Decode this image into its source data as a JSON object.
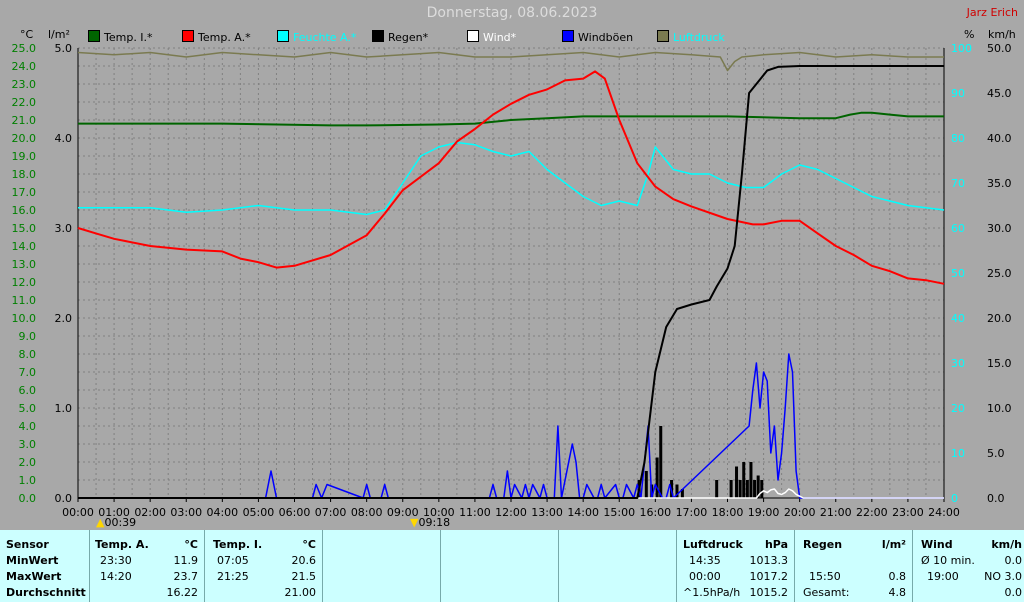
{
  "header": {
    "title": "Donnerstag, 08.06.2023",
    "author": "Jarz Erich",
    "unit_temp": "°C",
    "unit_rain": "l/m²",
    "unit_humidity": "%",
    "unit_wind": "km/h"
  },
  "legend": [
    {
      "label": "Temp. I.*",
      "color": "#006400"
    },
    {
      "label": "Temp. A.*",
      "color": "#ff0000"
    },
    {
      "label": "Feuchte A.*",
      "color": "#00ffff"
    },
    {
      "label": "Regen*",
      "color": "#000000"
    },
    {
      "label": "Wind*",
      "color": "#ffffff"
    },
    {
      "label": "Windböen",
      "color": "#0000ff"
    },
    {
      "label": "Luftdruck",
      "color": "#7a7a50"
    }
  ],
  "markers": [
    "00:39",
    "09:18"
  ],
  "chart_data": {
    "type": "line",
    "x_unit": "time of day (hours)",
    "x_ticks": [
      "00:00",
      "01:00",
      "02:00",
      "03:00",
      "04:00",
      "05:00",
      "06:00",
      "07:00",
      "08:00",
      "09:00",
      "10:00",
      "11:00",
      "12:00",
      "13:00",
      "14:00",
      "15:00",
      "16:00",
      "17:00",
      "18:00",
      "19:00",
      "20:00",
      "21:00",
      "22:00",
      "23:00",
      "24:00"
    ],
    "xlim": [
      0,
      24
    ],
    "axes": {
      "temp": {
        "ylim": [
          0,
          25
        ],
        "ticks": [
          "0.0",
          "1.0",
          "2.0",
          "3.0",
          "4.0",
          "5.0",
          "6.0",
          "7.0",
          "8.0",
          "9.0",
          "10.0",
          "11.0",
          "12.0",
          "13.0",
          "14.0",
          "15.0",
          "16.0",
          "17.0",
          "18.0",
          "19.0",
          "20.0",
          "21.0",
          "22.0",
          "23.0",
          "24.0",
          "25.0"
        ],
        "color": "#008000"
      },
      "rain": {
        "ylim": [
          0,
          5
        ],
        "ticks": [
          "0.0",
          "1.0",
          "2.0",
          "3.0",
          "4.0",
          "5.0"
        ],
        "color": "#000000"
      },
      "humidity": {
        "ylim": [
          0,
          100
        ],
        "ticks": [
          "0",
          "10",
          "20",
          "30",
          "40",
          "50",
          "60",
          "70",
          "80",
          "90",
          "100"
        ],
        "color": "#00ffff"
      },
      "wind": {
        "ylim": [
          0,
          50
        ],
        "ticks": [
          "0.0",
          "5.0",
          "10.0",
          "15.0",
          "20.0",
          "25.0",
          "30.0",
          "35.0",
          "40.0",
          "45.0",
          "50.0"
        ],
        "color": "#000000"
      }
    },
    "series": [
      {
        "name": "Temp. I.*",
        "axis": "temp",
        "color": "#006400",
        "x": [
          0,
          4,
          7,
          8,
          10,
          11,
          12,
          13,
          14,
          16,
          18,
          20,
          21,
          21.4,
          21.7,
          22,
          22.5,
          23,
          24
        ],
        "y": [
          20.8,
          20.8,
          20.7,
          20.7,
          20.75,
          20.8,
          21.0,
          21.1,
          21.2,
          21.2,
          21.2,
          21.1,
          21.1,
          21.3,
          21.4,
          21.4,
          21.3,
          21.2,
          21.2
        ]
      },
      {
        "name": "Temp. A.*",
        "axis": "temp",
        "color": "#ff0000",
        "x": [
          0,
          0.5,
          1,
          2,
          3,
          4,
          4.5,
          5,
          5.5,
          6,
          7,
          8,
          8.5,
          9,
          10,
          10.5,
          11,
          11.5,
          12,
          12.5,
          13,
          13.5,
          14,
          14.33,
          14.6,
          15,
          15.5,
          16,
          16.5,
          17,
          18,
          18.7,
          19,
          19.5,
          20,
          20.5,
          21,
          21.5,
          22,
          22.5,
          23,
          23.5,
          24
        ],
        "y": [
          15.0,
          14.7,
          14.4,
          14.0,
          13.8,
          13.7,
          13.3,
          13.1,
          12.8,
          12.9,
          13.5,
          14.6,
          15.8,
          17.1,
          18.6,
          19.8,
          20.5,
          21.3,
          21.9,
          22.4,
          22.7,
          23.2,
          23.3,
          23.7,
          23.3,
          21.0,
          18.6,
          17.3,
          16.6,
          16.2,
          15.5,
          15.2,
          15.2,
          15.4,
          15.4,
          14.7,
          14.0,
          13.5,
          12.9,
          12.6,
          12.2,
          12.1,
          11.9
        ]
      },
      {
        "name": "Feuchte A.*",
        "axis": "humidity",
        "color": "#00ffff",
        "x": [
          0,
          2,
          3,
          4,
          5,
          6,
          7,
          8,
          8.5,
          9,
          9.5,
          10,
          10.5,
          11,
          11.5,
          12,
          12.5,
          13,
          13.5,
          14,
          14.5,
          15,
          15.5,
          15.8,
          16,
          16.5,
          17,
          17.5,
          18,
          18.5,
          19,
          19.5,
          20,
          20.5,
          21,
          21.5,
          22,
          22.5,
          23,
          24
        ],
        "y": [
          64.5,
          64.5,
          63.5,
          64,
          65,
          64,
          64,
          63,
          64,
          70,
          76,
          78,
          79,
          78.5,
          77,
          76,
          77,
          73,
          70,
          67,
          65,
          66,
          65,
          72,
          78,
          73,
          72,
          72,
          70,
          69,
          69,
          72,
          74,
          73,
          71,
          69,
          67,
          66,
          65,
          64
        ]
      },
      {
        "name": "Regen*",
        "axis": "rain",
        "color": "#000000",
        "x": [
          0,
          15.5,
          15.7,
          16,
          16.3,
          16.6,
          17,
          17.5,
          17.7,
          18,
          18.2,
          18.4,
          18.6,
          18.9,
          19.1,
          19.4,
          20,
          21,
          24
        ],
        "y": [
          0,
          0,
          0.4,
          1.4,
          1.9,
          2.1,
          2.15,
          2.2,
          2.35,
          2.55,
          2.8,
          3.6,
          4.5,
          4.65,
          4.75,
          4.79,
          4.8,
          4.8,
          4.8
        ]
      },
      {
        "name": "Windböen",
        "axis": "wind",
        "color": "#0000ff",
        "x": [
          0,
          5.2,
          5.35,
          5.5,
          6.5,
          6.6,
          6.75,
          6.9,
          7.9,
          8.0,
          8.1,
          8.4,
          8.5,
          8.6,
          11.4,
          11.5,
          11.6,
          11.8,
          11.9,
          12.0,
          12.1,
          12.3,
          12.4,
          12.5,
          12.6,
          12.8,
          12.9,
          13.0,
          13.2,
          13.3,
          13.4,
          13.5,
          13.7,
          13.8,
          13.9,
          14.0,
          14.1,
          14.3,
          14.4,
          14.5,
          14.6,
          14.9,
          15.0,
          15.1,
          15.2,
          15.4,
          15.5,
          15.6,
          15.8,
          15.9,
          16.0,
          16.2,
          16.3,
          16.4,
          16.5,
          18.6,
          18.7,
          18.8,
          18.9,
          19.0,
          19.1,
          19.2,
          19.3,
          19.4,
          19.5,
          19.6,
          19.7,
          19.8,
          19.9,
          20.0,
          24
        ],
        "y": [
          0,
          0,
          3,
          0,
          0,
          1.5,
          0,
          1.5,
          0,
          1.5,
          0,
          0,
          1.5,
          0,
          0,
          1.5,
          0,
          0,
          3,
          0,
          1.5,
          0,
          1.5,
          0,
          1.5,
          0,
          1.5,
          0,
          0,
          8,
          0,
          2,
          6,
          4,
          0,
          0,
          1.5,
          0,
          0,
          1.5,
          0,
          1.5,
          0,
          0,
          1.5,
          0,
          1.5,
          0,
          8,
          0,
          1.5,
          0,
          0,
          1.5,
          0,
          8,
          12,
          15,
          10,
          14,
          13,
          5,
          8,
          2,
          5,
          10,
          16,
          14,
          3,
          0,
          0
        ]
      },
      {
        "name": "Wind*",
        "axis": "wind",
        "color": "#ffffff",
        "x": [
          0,
          18.8,
          18.9,
          19.0,
          19.1,
          19.2,
          19.3,
          19.4,
          19.5,
          19.6,
          19.7,
          19.8,
          19.9,
          20.0,
          20.1,
          24
        ],
        "y": [
          0,
          0,
          0.5,
          0.8,
          0.6,
          0.9,
          1.0,
          0.5,
          0.4,
          0.6,
          1.0,
          0.8,
          0.4,
          0.2,
          0,
          0
        ]
      },
      {
        "name": "Luftdruck",
        "axis": "humidity",
        "color": "#7a7a50",
        "x": [
          0,
          1,
          2,
          3,
          4,
          5,
          6,
          7,
          8,
          9,
          10,
          11,
          12,
          13,
          14,
          15,
          16,
          17,
          17.8,
          18.0,
          18.2,
          18.4,
          19,
          20,
          21,
          22,
          23,
          24
        ],
        "y": [
          99,
          98.5,
          99,
          98,
          99,
          98.5,
          98,
          99,
          98,
          98.5,
          99,
          98,
          98,
          98.5,
          99,
          98,
          99,
          98.5,
          98,
          95,
          97,
          98,
          98.5,
          99,
          98,
          98.5,
          98,
          98
        ]
      }
    ],
    "rain_bars": {
      "name": "Regen (Intervall)",
      "x": [
        15.55,
        15.75,
        15.9,
        16.05,
        16.15,
        16.45,
        16.6,
        16.75,
        17.7,
        18.1,
        18.25,
        18.35,
        18.45,
        18.55,
        18.65,
        18.75,
        18.85,
        18.95
      ],
      "y": [
        0.2,
        0.3,
        0.15,
        0.45,
        0.8,
        0.2,
        0.15,
        0.1,
        0.2,
        0.2,
        0.35,
        0.2,
        0.4,
        0.2,
        0.4,
        0.2,
        0.25,
        0.2
      ]
    }
  },
  "info": {
    "sensor": {
      "header": "Sensor",
      "rows": [
        "MinWert",
        "MaxWert",
        "Durchschnitt"
      ]
    },
    "temp_a": {
      "header": "Temp. A.",
      "unit": "°C",
      "rows": [
        {
          "time": "23:30",
          "value": "11.9"
        },
        {
          "time": "14:20",
          "value": "23.7"
        },
        {
          "time": "",
          "value": "16.22"
        }
      ]
    },
    "temp_i": {
      "header": "Temp. I.",
      "unit": "°C",
      "rows": [
        {
          "time": "07:05",
          "value": "20.6"
        },
        {
          "time": "21:25",
          "value": "21.5"
        },
        {
          "time": "",
          "value": "21.00"
        }
      ]
    },
    "pressure": {
      "header": "Luftdruck",
      "unit": "hPa",
      "rows": [
        {
          "time": "14:35",
          "value": "1013.3"
        },
        {
          "time": "00:00",
          "value": "1017.2"
        },
        {
          "time": "^1.5hPa/h",
          "value": "1015.2"
        }
      ]
    },
    "rain": {
      "header": "Regen",
      "unit": "l/m²",
      "rows": [
        {
          "time": "",
          "value": ""
        },
        {
          "time": "15:50",
          "value": "0.8"
        },
        {
          "time": "Gesamt:",
          "value": "4.8"
        }
      ]
    },
    "wind": {
      "header": "Wind",
      "unit": "km/h",
      "rows": [
        {
          "time": "Ø 10 min.",
          "value": "0.0"
        },
        {
          "time": "19:00",
          "value": "NO 3.0"
        },
        {
          "time": "",
          "value": "0.0"
        }
      ]
    }
  }
}
